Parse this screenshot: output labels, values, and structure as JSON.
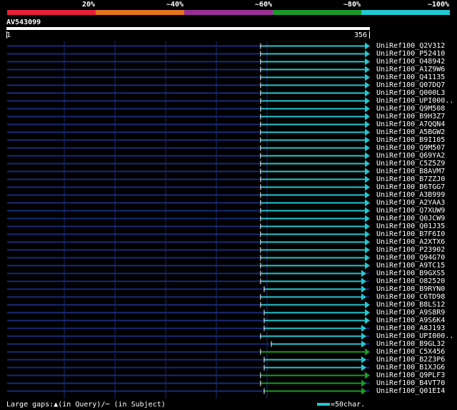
{
  "legend": {
    "segments": [
      {
        "label": "20%",
        "color": "#e8203a"
      },
      {
        "label": "~40%",
        "color": "#e4731e"
      },
      {
        "label": "~60%",
        "color": "#9a3096"
      },
      {
        "label": "~80%",
        "color": "#1a9a28"
      },
      {
        "label": "~100%",
        "color": "#22c8d2"
      }
    ]
  },
  "query": {
    "name": "AV543099",
    "start": "1",
    "end": "356"
  },
  "grid_color": "#1a2a7a",
  "hits": [
    {
      "label": "UniRef100_Q2V312",
      "color": "#22c8d2",
      "start": 0.7,
      "end": 1.0
    },
    {
      "label": "UniRef100_P52410",
      "color": "#22c8d2",
      "start": 0.7,
      "end": 1.0
    },
    {
      "label": "UniRef100_O48942",
      "color": "#22c8d2",
      "start": 0.7,
      "end": 1.0
    },
    {
      "label": "UniRef100_A1Z9W6",
      "color": "#22c8d2",
      "start": 0.7,
      "end": 1.0
    },
    {
      "label": "UniRef100_Q41135",
      "color": "#22c8d2",
      "start": 0.7,
      "end": 1.0
    },
    {
      "label": "UniRef100_Q07DQ7",
      "color": "#22c8d2",
      "start": 0.7,
      "end": 1.0
    },
    {
      "label": "UniRef100_Q000L3",
      "color": "#22c8d2",
      "start": 0.7,
      "end": 1.0
    },
    {
      "label": "UniRef100_UPI000..",
      "color": "#22c8d2",
      "start": 0.7,
      "end": 1.0
    },
    {
      "label": "UniRef100_Q9M508",
      "color": "#22c8d2",
      "start": 0.7,
      "end": 1.0
    },
    {
      "label": "UniRef100_B9H3Z7",
      "color": "#22c8d2",
      "start": 0.7,
      "end": 1.0
    },
    {
      "label": "UniRef100_A7QQN4",
      "color": "#22c8d2",
      "start": 0.7,
      "end": 1.0
    },
    {
      "label": "UniRef100_A5BGW2",
      "color": "#22c8d2",
      "start": 0.7,
      "end": 1.0
    },
    {
      "label": "UniRef100_B9I105",
      "color": "#22c8d2",
      "start": 0.7,
      "end": 1.0
    },
    {
      "label": "UniRef100_Q9M507",
      "color": "#22c8d2",
      "start": 0.7,
      "end": 1.0
    },
    {
      "label": "UniRef100_Q69YA2",
      "color": "#22c8d2",
      "start": 0.7,
      "end": 1.0
    },
    {
      "label": "UniRef100_C5Z5Z9",
      "color": "#22c8d2",
      "start": 0.7,
      "end": 1.0
    },
    {
      "label": "UniRef100_B8AVM7",
      "color": "#22c8d2",
      "start": 0.7,
      "end": 1.0
    },
    {
      "label": "UniRef100_B7ZZJ0",
      "color": "#22c8d2",
      "start": 0.7,
      "end": 1.0
    },
    {
      "label": "UniRef100_B6TGG7",
      "color": "#22c8d2",
      "start": 0.7,
      "end": 1.0
    },
    {
      "label": "UniRef100_A3B999",
      "color": "#22c8d2",
      "start": 0.7,
      "end": 1.0
    },
    {
      "label": "UniRef100_A2YAA3",
      "color": "#22c8d2",
      "start": 0.7,
      "end": 1.0
    },
    {
      "label": "UniRef100_Q7XUW9",
      "color": "#22c8d2",
      "start": 0.7,
      "end": 1.0
    },
    {
      "label": "UniRef100_Q0JCW9",
      "color": "#22c8d2",
      "start": 0.7,
      "end": 1.0
    },
    {
      "label": "UniRef100_Q01J35",
      "color": "#22c8d2",
      "start": 0.7,
      "end": 1.0
    },
    {
      "label": "UniRef100_B7F6I0",
      "color": "#22c8d2",
      "start": 0.7,
      "end": 1.0
    },
    {
      "label": "UniRef100_A2XTX6",
      "color": "#22c8d2",
      "start": 0.7,
      "end": 1.0
    },
    {
      "label": "UniRef100_P23902",
      "color": "#22c8d2",
      "start": 0.7,
      "end": 1.0
    },
    {
      "label": "UniRef100_Q94G70",
      "color": "#22c8d2",
      "start": 0.7,
      "end": 1.0
    },
    {
      "label": "UniRef100_A9TC15",
      "color": "#22c8d2",
      "start": 0.7,
      "end": 1.0
    },
    {
      "label": "UniRef100_B9GXS5",
      "color": "#22c8d2",
      "start": 0.7,
      "end": 0.99
    },
    {
      "label": "UniRef100_O82520",
      "color": "#22c8d2",
      "start": 0.7,
      "end": 0.99
    },
    {
      "label": "UniRef100_B9RYN0",
      "color": "#22c8d2",
      "start": 0.71,
      "end": 0.99
    },
    {
      "label": "UniRef100_C6TD98",
      "color": "#22c8d2",
      "start": 0.7,
      "end": 0.99
    },
    {
      "label": "UniRef100_B8LS12",
      "color": "#22c8d2",
      "start": 0.7,
      "end": 1.0
    },
    {
      "label": "UniRef100_A9S8R9",
      "color": "#22c8d2",
      "start": 0.71,
      "end": 1.0
    },
    {
      "label": "UniRef100_A9S6K4",
      "color": "#22c8d2",
      "start": 0.71,
      "end": 1.0
    },
    {
      "label": "UniRef100_A8J193",
      "color": "#22c8d2",
      "start": 0.71,
      "end": 0.99
    },
    {
      "label": "UniRef100_UPI000..",
      "color": "#22c8d2",
      "start": 0.7,
      "end": 0.99
    },
    {
      "label": "UniRef100_B9GL32",
      "color": "#22c8d2",
      "start": 0.73,
      "end": 0.99
    },
    {
      "label": "UniRef100_C5X456",
      "color": "#1a9a28",
      "start": 0.7,
      "end": 1.0
    },
    {
      "label": "UniRef100_B2Z3P6",
      "color": "#22c8d2",
      "start": 0.71,
      "end": 0.99
    },
    {
      "label": "UniRef100_B1XJG6",
      "color": "#22c8d2",
      "start": 0.71,
      "end": 0.99
    },
    {
      "label": "UniRef100_Q9PLF3",
      "color": "#1a9a28",
      "start": 0.7,
      "end": 1.0
    },
    {
      "label": "UniRef100_B4VT70",
      "color": "#1a9a28",
      "start": 0.7,
      "end": 0.99
    },
    {
      "label": "UniRef100_Q01EI4",
      "color": "#1a9a28",
      "start": 0.71,
      "end": 0.99
    }
  ],
  "footer": {
    "gaps_text": "Large gaps:▲(in Query)/─ (in Subject)",
    "scale_text": "=50char."
  }
}
